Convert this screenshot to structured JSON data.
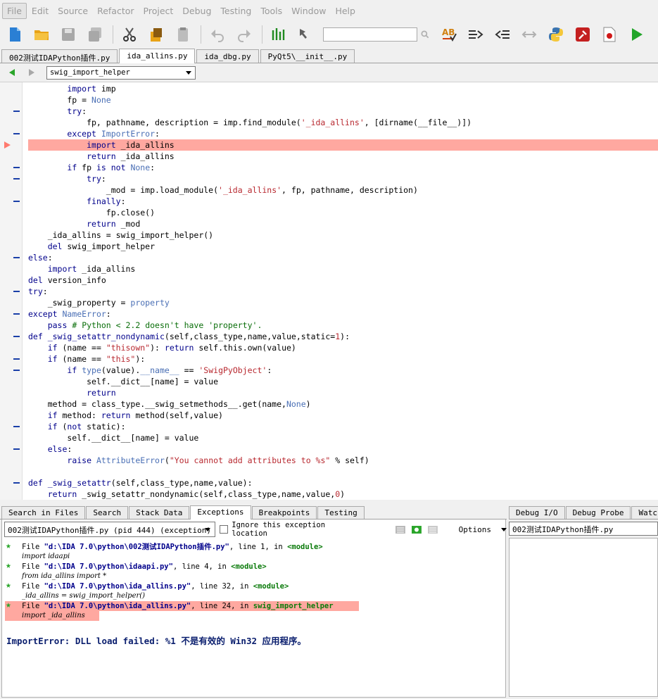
{
  "menu": [
    "File",
    "Edit",
    "Source",
    "Refactor",
    "Project",
    "Debug",
    "Testing",
    "Tools",
    "Window",
    "Help"
  ],
  "toolbar": {
    "search_value": "",
    "icons": [
      "new-file-icon",
      "open-folder-icon",
      "save-icon",
      "save-all-icon",
      "cut-icon",
      "copy-icon",
      "paste-icon",
      "undo-icon",
      "redo-icon",
      "indent-guides-icon",
      "goto-icon",
      "search-icon",
      "spell-check-icon",
      "indent-icon",
      "outdent-icon",
      "swap-icon",
      "python-shell-icon",
      "preferences-icon",
      "record-icon",
      "run-icon"
    ]
  },
  "file_tabs": [
    {
      "label": "002测试IDAPython插件.py",
      "active": false
    },
    {
      "label": "ida_allins.py",
      "active": true
    },
    {
      "label": "ida_dbg.py",
      "active": false
    },
    {
      "label": "PyQt5\\__init__.py",
      "active": false
    }
  ],
  "scope": {
    "selected": "swig_import_helper"
  },
  "code": [
    {
      "html": "        <span class='kw'>import</span> imp",
      "fold": false
    },
    {
      "html": "        fp = <span class='bi'>None</span>",
      "fold": false
    },
    {
      "html": "        <span class='kw'>try</span>:",
      "fold": true
    },
    {
      "html": "            fp, pathname, description = imp.find_module(<span class='st'>'_ida_allins'</span>, [dirname(__file__)])",
      "fold": false
    },
    {
      "html": "        <span class='kw'>except</span> <span class='bi'>ImportError</span>:",
      "fold": true
    },
    {
      "html": "            <span class='kw'>import</span> _ida_allins",
      "fold": false,
      "hl": true
    },
    {
      "html": "            <span class='kw'>return</span> _ida_allins",
      "fold": false
    },
    {
      "html": "        <span class='kw'>if</span> fp <span class='kw'>is not</span> <span class='bi'>None</span>:",
      "fold": true
    },
    {
      "html": "            <span class='kw'>try</span>:",
      "fold": true
    },
    {
      "html": "                _mod = imp.load_module(<span class='st'>'_ida_allins'</span>, fp, pathname, description)",
      "fold": false
    },
    {
      "html": "            <span class='kw'>finally</span>:",
      "fold": true
    },
    {
      "html": "                fp.close()",
      "fold": false
    },
    {
      "html": "            <span class='kw'>return</span> _mod",
      "fold": false
    },
    {
      "html": "    _ida_allins = swig_import_helper()",
      "fold": false
    },
    {
      "html": "    <span class='kw'>del</span> swig_import_helper",
      "fold": false
    },
    {
      "html": "<span class='kw'>else</span>:",
      "fold": true
    },
    {
      "html": "    <span class='kw'>import</span> _ida_allins",
      "fold": false
    },
    {
      "html": "<span class='kw'>del</span> version_info",
      "fold": false
    },
    {
      "html": "<span class='kw'>try</span>:",
      "fold": true
    },
    {
      "html": "    _swig_property = <span class='bi'>property</span>",
      "fold": false
    },
    {
      "html": "<span class='kw'>except</span> <span class='bi'>NameError</span>:",
      "fold": true
    },
    {
      "html": "    <span class='kw'>pass</span> <span class='cm'># Python &lt; 2.2 doesn't have 'property'.</span>",
      "fold": false
    },
    {
      "html": "<span class='kw'>def</span> <span class='kw'>_swig_setattr_nondynamic</span>(self,class_type,name,value,static=<span class='nm'>1</span>):",
      "fold": true
    },
    {
      "html": "    <span class='kw'>if</span> (name == <span class='st'>\"thisown\"</span>): <span class='kw'>return</span> self.this.own(value)",
      "fold": false
    },
    {
      "html": "    <span class='kw'>if</span> (name == <span class='st'>\"this\"</span>):",
      "fold": true
    },
    {
      "html": "        <span class='kw'>if</span> <span class='bi'>type</span>(value).<span class='bi'>__name__</span> == <span class='st'>'SwigPyObject'</span>:",
      "fold": true
    },
    {
      "html": "            self.__dict__[name] = value",
      "fold": false
    },
    {
      "html": "            <span class='kw'>return</span>",
      "fold": false
    },
    {
      "html": "    method = class_type.__swig_setmethods__.get(name,<span class='bi'>None</span>)",
      "fold": false
    },
    {
      "html": "    <span class='kw'>if</span> method: <span class='kw'>return</span> method(self,value)",
      "fold": false
    },
    {
      "html": "    <span class='kw'>if</span> (<span class='kw'>not</span> static):",
      "fold": true
    },
    {
      "html": "        self.__dict__[name] = value",
      "fold": false
    },
    {
      "html": "    <span class='kw'>else</span>:",
      "fold": true
    },
    {
      "html": "        <span class='kw'>raise</span> <span class='bi'>AttributeError</span>(<span class='st'>\"You cannot add attributes to %s\"</span> % self)",
      "fold": false
    },
    {
      "html": "",
      "fold": false
    },
    {
      "html": "<span class='kw'>def</span> <span class='kw'>_swig_setattr</span>(self,class_type,name,value):",
      "fold": true
    },
    {
      "html": "    <span class='kw'>return</span> _swig_setattr_nondynamic(self,class_type,name,value,<span class='nm'>0</span>)",
      "fold": false
    }
  ],
  "bottom_tabs": [
    {
      "label": "Search in Files",
      "active": false
    },
    {
      "label": "Search",
      "active": false
    },
    {
      "label": "Stack Data",
      "active": false
    },
    {
      "label": "Exceptions",
      "active": true
    },
    {
      "label": "Breakpoints",
      "active": false
    },
    {
      "label": "Testing",
      "active": false
    }
  ],
  "right_tabs": [
    "Debug I/O",
    "Debug Probe",
    "Watch"
  ],
  "exceptions": {
    "process_selected": "002测试IDAPython插件.py (pid 444) (exception)",
    "ignore_label": "Ignore this exception location",
    "options_label": "Options",
    "traceback": [
      {
        "prefix": "File ",
        "path": "\"d:\\IDA 7.0\\python\\002测试IDAPython插件.py\"",
        "mid": ", line 1, in ",
        "module": "<module>",
        "code": "import idaapi",
        "hl": false
      },
      {
        "prefix": "File ",
        "path": "\"d:\\IDA 7.0\\python\\idaapi.py\"",
        "mid": ", line 4, in ",
        "module": "<module>",
        "code": "from ida_allins import *",
        "hl": false
      },
      {
        "prefix": "File ",
        "path": "\"d:\\IDA 7.0\\python\\ida_allins.py\"",
        "mid": ", line 32, in ",
        "module": "<module>",
        "code": "_ida_allins = swig_import_helper()",
        "hl": false
      },
      {
        "prefix": "File ",
        "path": "\"d:\\IDA 7.0\\python\\ida_allins.py\"",
        "mid": ", line 24, in ",
        "module": "swig_import_helper",
        "code": "import _ida_allins",
        "hl": true
      }
    ],
    "error": "ImportError: DLL load failed: %1 不是有效的 Win32 应用程序。"
  },
  "debug_io": {
    "selected": "002测试IDAPython插件.py"
  }
}
